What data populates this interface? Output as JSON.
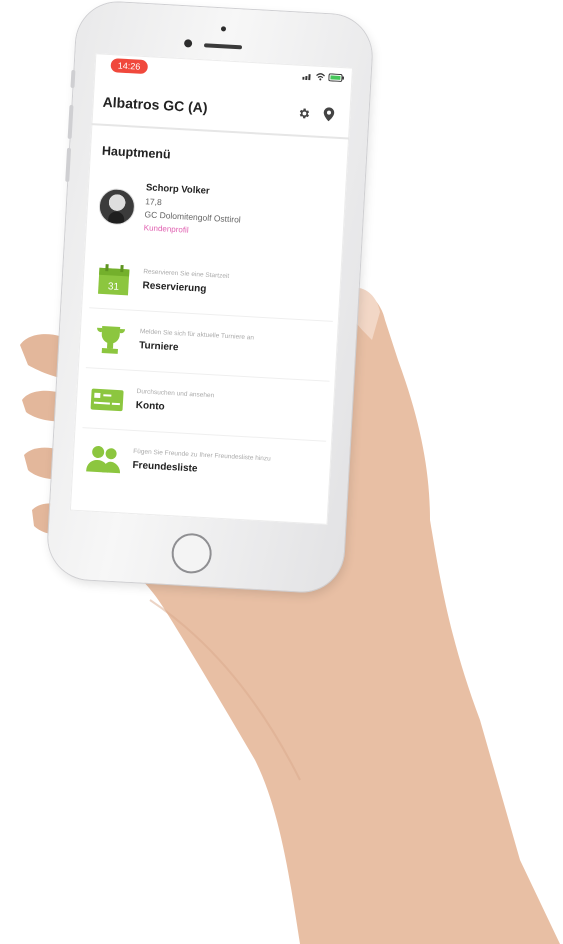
{
  "status_bar": {
    "time": "14:26"
  },
  "header": {
    "title": "Albatros GC (A)"
  },
  "main": {
    "section_title": "Hauptmenü",
    "profile": {
      "name": "Schorp Volker",
      "handicap": "17,8",
      "club": "GC Dolomitengolf Osttirol",
      "link": "Kundenprofil"
    },
    "menu": [
      {
        "subtitle": "Reservieren Sie eine Startzeit",
        "label": "Reservierung",
        "icon": "calendar-icon",
        "calendar_day": "31"
      },
      {
        "subtitle": "Melden Sie sich für aktuelle Turniere an",
        "label": "Turniere",
        "icon": "trophy-icon"
      },
      {
        "subtitle": "Durchsuchen und ansehen",
        "label": "Konto",
        "icon": "card-icon"
      },
      {
        "subtitle": "Fügen Sie Freunde zu Ihrer Freundesliste hinzu",
        "label": "Freundesliste",
        "icon": "friends-icon"
      }
    ]
  },
  "colors": {
    "accent": "#8cc63f",
    "link": "#e05fb0",
    "time_pill": "#f0483c"
  }
}
